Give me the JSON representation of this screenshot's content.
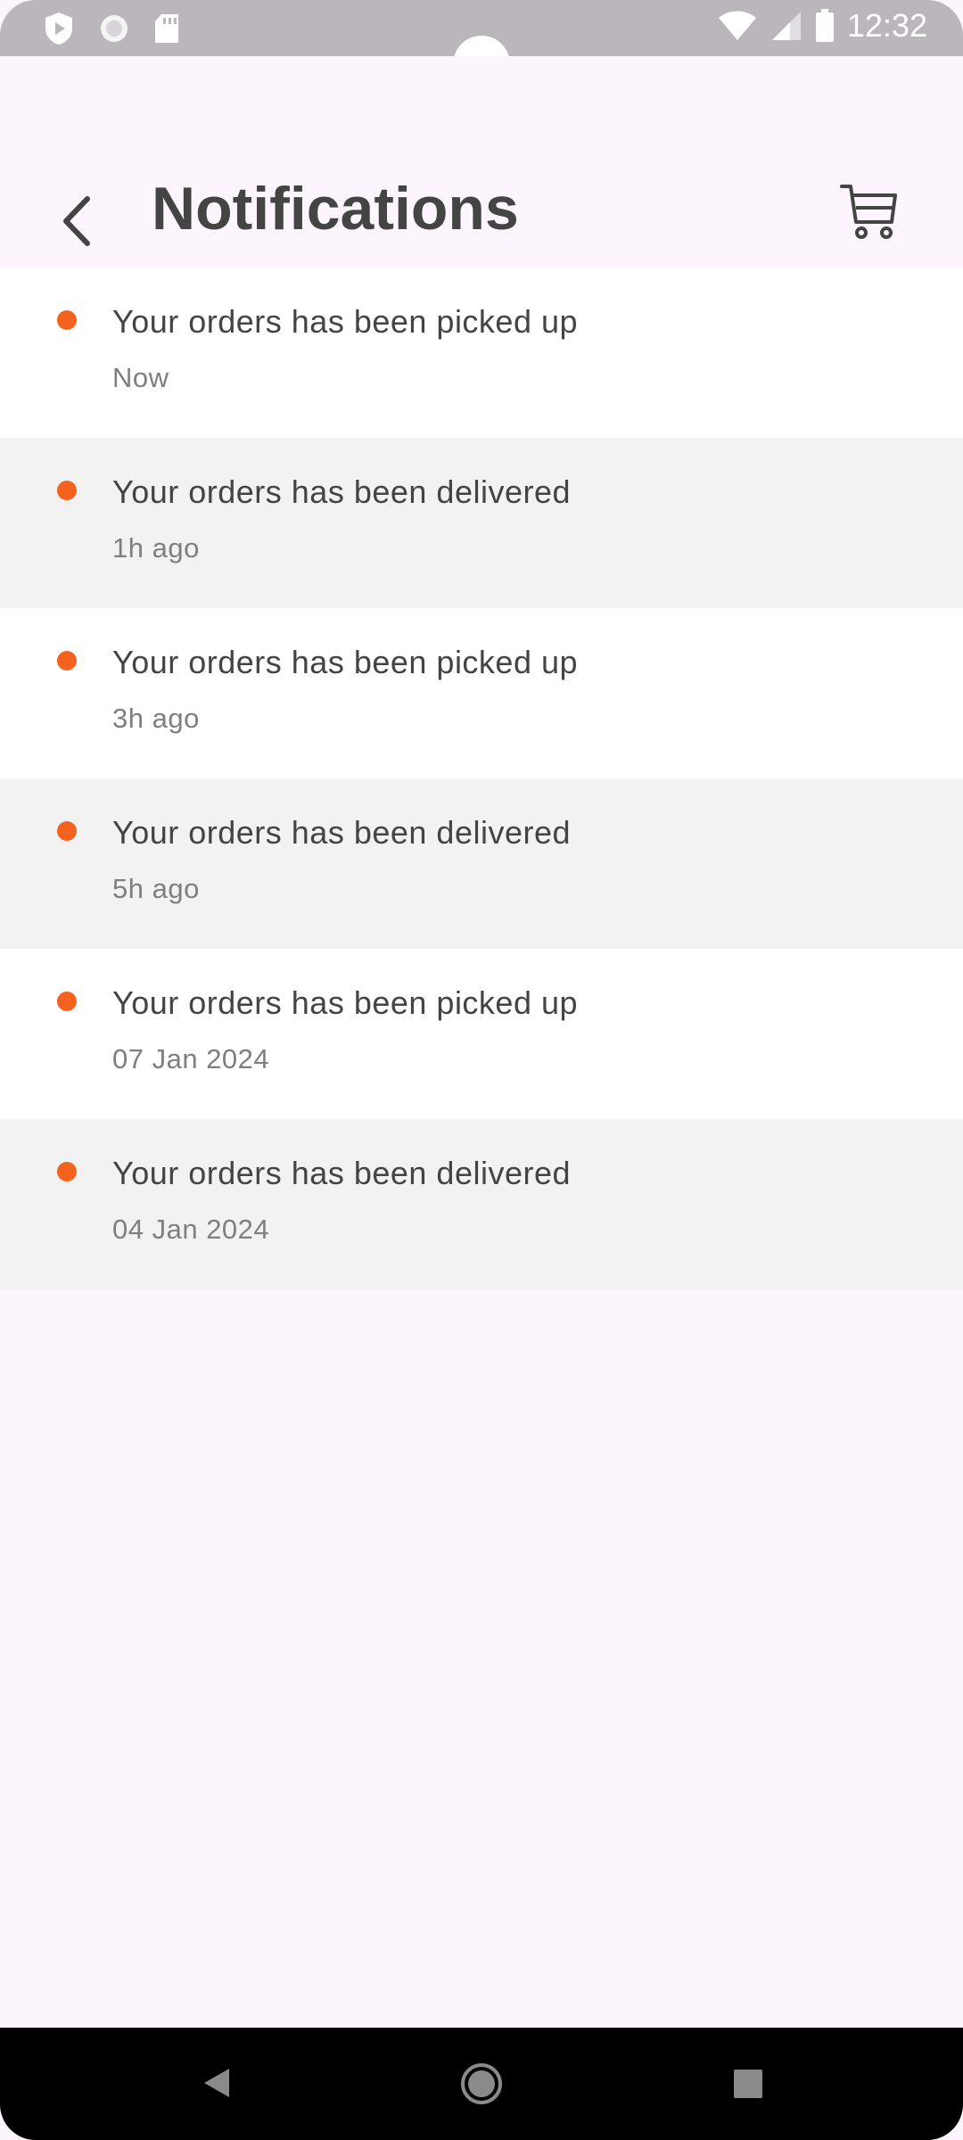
{
  "status_bar": {
    "time": "12:32",
    "left_icons": [
      "shield-icon",
      "circle-status-icon",
      "sd-card-icon"
    ],
    "right_icons": [
      "wifi-icon",
      "signal-icon",
      "battery-icon"
    ]
  },
  "header": {
    "title": "Notifications",
    "back_icon": "chevron-left-icon",
    "cart_icon": "cart-icon"
  },
  "notifications": [
    {
      "message": "Your orders has been picked up",
      "time": "Now"
    },
    {
      "message": "Your orders has been delivered",
      "time": "1h ago"
    },
    {
      "message": "Your orders has been picked up",
      "time": "3h ago"
    },
    {
      "message": "Your orders has been delivered",
      "time": "5h ago"
    },
    {
      "message": "Your orders has been picked up",
      "time": "07 Jan 2024"
    },
    {
      "message": "Your orders has been delivered",
      "time": "04 Jan 2024"
    }
  ],
  "colors": {
    "accent_dot": "#F4621F",
    "background": "#FCF5FD",
    "row_alt": "#F2F2F2",
    "text": "#444444",
    "subtext": "#7F7F7F"
  },
  "nav_bar": {
    "icons": [
      "nav-back-icon",
      "nav-home-icon",
      "nav-recents-icon"
    ]
  }
}
